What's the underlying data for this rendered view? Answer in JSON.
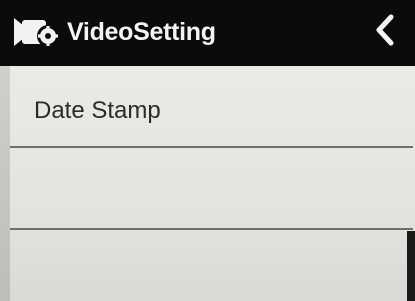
{
  "header": {
    "title": "VideoSetting",
    "camera_icon": "video-camera-gear-icon",
    "back_icon": "chevron-left-icon"
  },
  "menu": {
    "items": [
      {
        "label": "Date Stamp"
      },
      {
        "label": ""
      },
      {
        "label": ""
      }
    ]
  },
  "colors": {
    "header_bg": "#0b0b0b",
    "header_text": "#f4f4f4",
    "menu_bg": "#e6e6e3",
    "divider": "#6f6f6c",
    "item_text": "#2b2b2b"
  }
}
